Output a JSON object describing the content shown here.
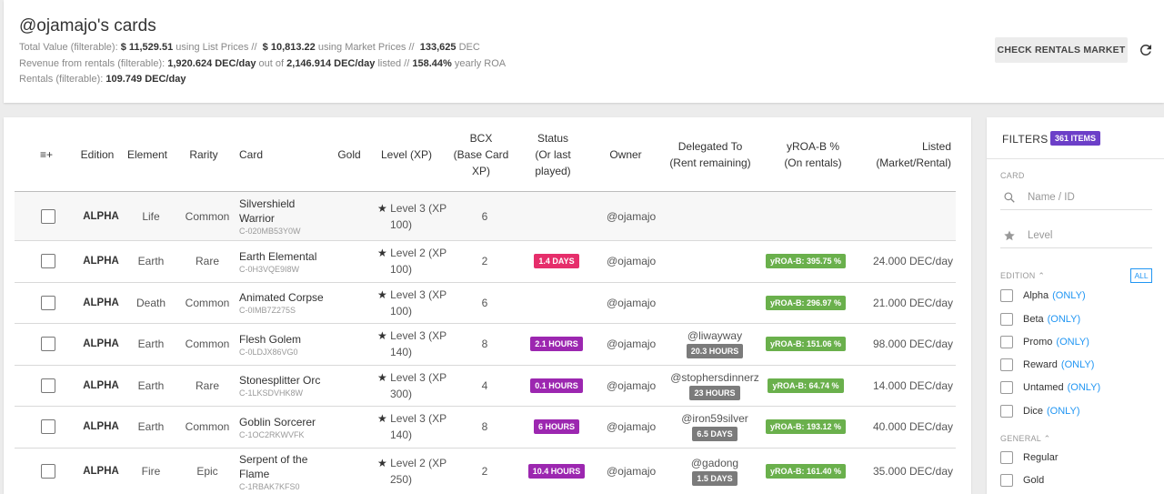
{
  "header": {
    "title": "@ojamajo's cards",
    "total_value_label": "Total Value (filterable):",
    "total_list_value": "$ 11,529.51",
    "list_prices_text": "using List Prices //",
    "total_market_value": "$ 10,813.22",
    "market_prices_text": "using Market Prices //",
    "total_dec": "133,625",
    "dec_unit": "DEC",
    "revenue_label": "Revenue from rentals (filterable):",
    "revenue_value": "1,920.624 DEC/day",
    "out_of_text": "out of",
    "listed_value": "2,146.914 DEC/day",
    "listed_text": "listed //",
    "roa_value": "158.44%",
    "roa_text": "yearly ROA",
    "rentals_label": "Rentals (filterable):",
    "rentals_value": "109.749 DEC/day",
    "check_button": "CHECK RENTALS MARKET",
    "refresh_icon": "refresh-icon"
  },
  "table": {
    "columns": {
      "select_icon": "≡+",
      "edition": "Edition",
      "element": "Element",
      "rarity": "Rarity",
      "card": "Card",
      "gold": "Gold",
      "level": "Level (XP)",
      "bcx_line1": "BCX",
      "bcx_line2": "(Base Card",
      "bcx_line3": "XP)",
      "status_line1": "Status",
      "status_line2": "(Or last",
      "status_line3": "played)",
      "owner": "Owner",
      "delegated_line1": "Delegated To",
      "delegated_line2": "(Rent remaining)",
      "yroa_line1": "yROA-B %",
      "yroa_line2": "(On rentals)",
      "listed_line1": "Listed",
      "listed_line2": "(Market/Rental)"
    },
    "rows": [
      {
        "edition": "ALPHA",
        "element": "Life",
        "rarity": "Common",
        "name_line1": "Silvershield",
        "name_line2": "Warrior",
        "id": "C-020MB53Y0W",
        "level_line1": "Level 3 (XP",
        "level_line2": "100)",
        "bcx": "6",
        "status": "",
        "owner": "@ojamajo",
        "delegate": "",
        "remaining": "",
        "yroa": "",
        "listed": ""
      },
      {
        "edition": "ALPHA",
        "element": "Earth",
        "rarity": "Rare",
        "name_line1": "Earth Elemental",
        "name_line2": "",
        "id": "C-0H3VQE9I8W",
        "level_line1": "Level 2 (XP",
        "level_line2": "100)",
        "bcx": "2",
        "status": "1.4 DAYS",
        "owner": "@ojamajo",
        "delegate": "",
        "remaining": "",
        "yroa": "yROA-B: 395.75 %",
        "listed": "24.000 DEC/day"
      },
      {
        "edition": "ALPHA",
        "element": "Death",
        "rarity": "Common",
        "name_line1": "Animated Corpse",
        "name_line2": "",
        "id": "C-0IMB7Z275S",
        "level_line1": "Level 3 (XP",
        "level_line2": "100)",
        "bcx": "6",
        "status": "",
        "owner": "@ojamajo",
        "delegate": "",
        "remaining": "",
        "yroa": "yROA-B: 296.97 %",
        "listed": "21.000 DEC/day"
      },
      {
        "edition": "ALPHA",
        "element": "Earth",
        "rarity": "Common",
        "name_line1": "Flesh Golem",
        "name_line2": "",
        "id": "C-0LDJX86VG0",
        "level_line1": "Level 3 (XP",
        "level_line2": "140)",
        "bcx": "8",
        "status": "2.1 HOURS",
        "owner": "@ojamajo",
        "delegate": "@liwayway",
        "remaining": "20.3 HOURS",
        "yroa": "yROA-B: 151.06 %",
        "listed": "98.000 DEC/day"
      },
      {
        "edition": "ALPHA",
        "element": "Earth",
        "rarity": "Rare",
        "name_line1": "Stonesplitter Orc",
        "name_line2": "",
        "id": "C-1LKSDVHK8W",
        "level_line1": "Level 3 (XP",
        "level_line2": "300)",
        "bcx": "4",
        "status": "0.1 HOURS",
        "owner": "@ojamajo",
        "delegate": "@stophersdinnerz",
        "remaining": "23 HOURS",
        "yroa": "yROA-B: 64.74 %",
        "listed": "14.000 DEC/day"
      },
      {
        "edition": "ALPHA",
        "element": "Earth",
        "rarity": "Common",
        "name_line1": "Goblin Sorcerer",
        "name_line2": "",
        "id": "C-1OC2RKWVFK",
        "level_line1": "Level 3 (XP",
        "level_line2": "140)",
        "bcx": "8",
        "status": "6 HOURS",
        "owner": "@ojamajo",
        "delegate": "@iron59silver",
        "remaining": "6.5 DAYS",
        "yroa": "yROA-B: 193.12 %",
        "listed": "40.000 DEC/day"
      },
      {
        "edition": "ALPHA",
        "element": "Fire",
        "rarity": "Epic",
        "name_line1": "Serpent of the",
        "name_line2": "Flame",
        "id": "C-1RBAK7KFS0",
        "level_line1": "Level 2 (XP",
        "level_line2": "250)",
        "bcx": "2",
        "status": "10.4 HOURS",
        "owner": "@ojamajo",
        "delegate": "@gadong",
        "remaining": "1.5 DAYS",
        "yroa": "yROA-B: 161.40 %",
        "listed": "35.000 DEC/day"
      }
    ]
  },
  "filters": {
    "title": "FILTERS",
    "count": "361 ITEMS",
    "card_label": "CARD",
    "search_placeholder": "Name / ID",
    "level_placeholder": "Level",
    "edition_label": "EDITION",
    "all_button": "ALL",
    "only_text": "(ONLY)",
    "editions": [
      "Alpha",
      "Beta",
      "Promo",
      "Reward",
      "Untamed",
      "Dice"
    ],
    "general_label": "GENERAL",
    "general": [
      "Regular",
      "Gold"
    ]
  },
  "colors": {
    "status_recent": "#e62e6b",
    "status_hours": "#9c27b0",
    "yroa_badge": "#6ab04c",
    "remaining_badge": "#7b7b7b",
    "count_badge": "#6c3fc8",
    "link_blue": "#2196f3"
  }
}
